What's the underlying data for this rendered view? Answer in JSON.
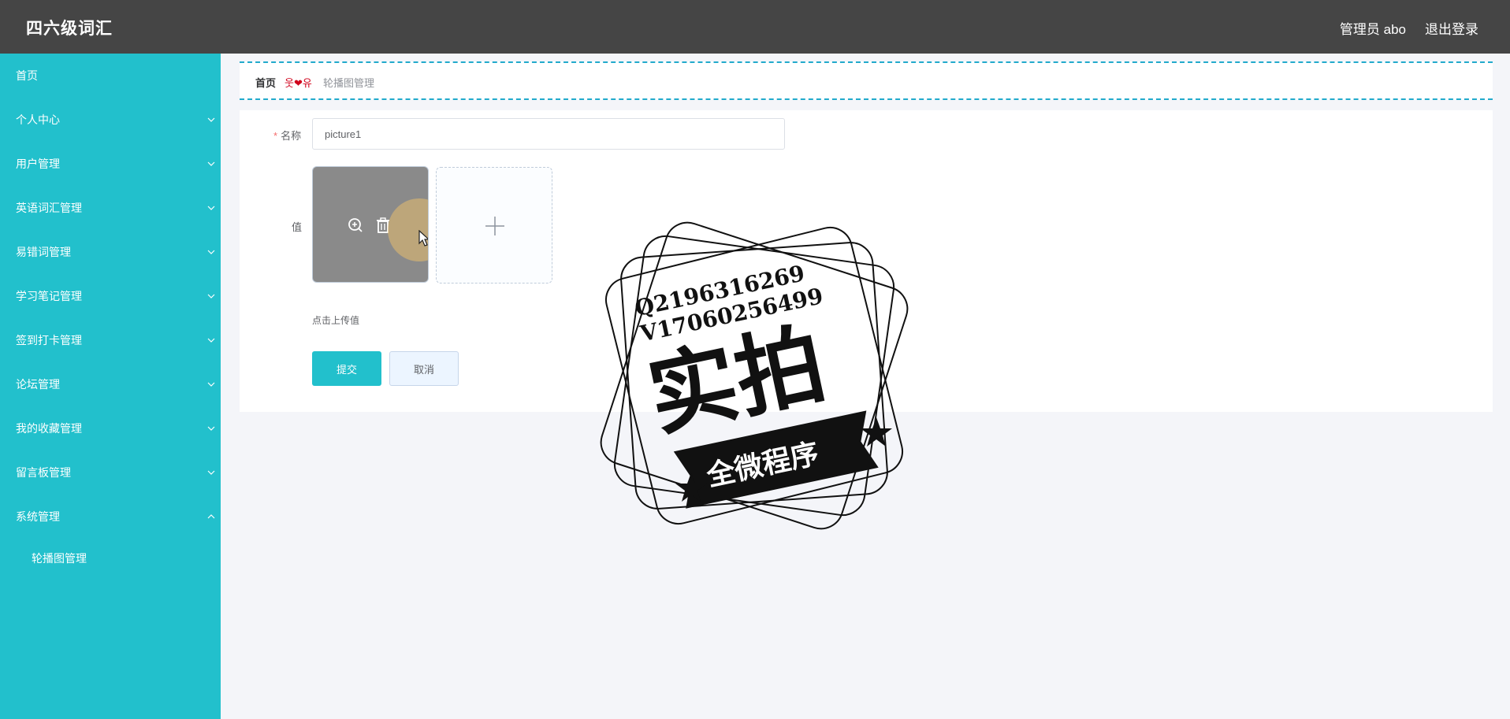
{
  "app": {
    "title": "四六级词汇"
  },
  "header": {
    "admin_label": "管理员 abo",
    "logout_label": "退出登录"
  },
  "sidebar": {
    "items": [
      {
        "label": "首页",
        "expandable": false
      },
      {
        "label": "个人中心",
        "expandable": true
      },
      {
        "label": "用户管理",
        "expandable": true
      },
      {
        "label": "英语词汇管理",
        "expandable": true
      },
      {
        "label": "易错词管理",
        "expandable": true
      },
      {
        "label": "学习笔记管理",
        "expandable": true
      },
      {
        "label": "签到打卡管理",
        "expandable": true
      },
      {
        "label": "论坛管理",
        "expandable": true
      },
      {
        "label": "我的收藏管理",
        "expandable": true
      },
      {
        "label": "留言板管理",
        "expandable": true
      },
      {
        "label": "系统管理",
        "expandable": true,
        "expanded": true
      }
    ],
    "subitems": [
      {
        "label": "轮播图管理"
      }
    ]
  },
  "breadcrumb": {
    "home": "首页",
    "separator": "웃❤유",
    "current": "轮播图管理"
  },
  "form": {
    "name_label": "名称",
    "required_mark": "*",
    "name_value": "picture1",
    "value_label": "值",
    "upload_hint": "点击上传值",
    "submit_label": "提交",
    "cancel_label": "取消"
  },
  "icons": {
    "thumb_actions": [
      "zoom-in-icon",
      "delete-icon"
    ],
    "uploader": "plus-icon",
    "menu": "chevron-down-icon"
  },
  "watermark": {
    "line1": "Q2196316269",
    "line2": "V17060256499",
    "main": "实拍",
    "ribbon": "全微程序"
  },
  "colors": {
    "accent": "#22c0cc",
    "header_bg": "#454545",
    "page_bg": "#f4f5f9"
  }
}
